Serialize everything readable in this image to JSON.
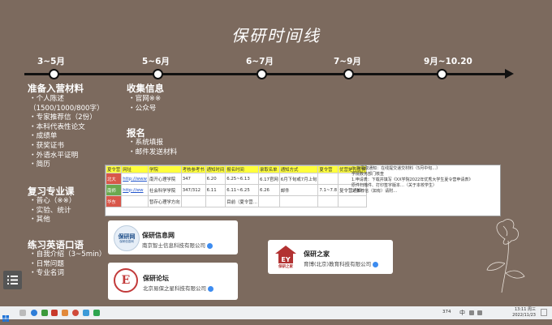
{
  "title": "保研时间线",
  "milestones": [
    "3~5月",
    "5~6月",
    "6~7月",
    "7~9月",
    "9月~10.20"
  ],
  "col1": {
    "sections": [
      {
        "title": "准备入营材料",
        "items": [
          "・个人陈述",
          "（1500/1000/800字）",
          "・专家推荐信（2份）",
          "・本科代表性论文",
          "・成绩单",
          "・获奖证书",
          "・外语水平证明",
          "・简历"
        ]
      },
      {
        "title": "复习专业课",
        "items": [
          "・普心（※※）",
          "・实验、统计",
          "・其他"
        ]
      },
      {
        "title": "练习英语口语",
        "items": [
          "・自我介绍（3~5min）",
          "・日常问题",
          "・专业名词"
        ]
      }
    ]
  },
  "col2": {
    "sections": [
      {
        "title": "收集信息",
        "items": [
          "・官网※※",
          "・公众号"
        ]
      },
      {
        "title": "报名",
        "items": [
          "・系统填报",
          "・邮件发送材料"
        ]
      }
    ]
  },
  "spreadsheet": {
    "headers": [
      "夏令营",
      "网址",
      "学院",
      "考核参考书",
      "通知时间",
      "报名时间",
      "录取名单",
      "通知方式",
      "夏令营",
      "优营是否直博"
    ],
    "rows": [
      {
        "tag": "北大",
        "cells": [
          "http://www",
          "南开心理学院",
          "347",
          "6.20",
          "6.25~6.13",
          "6.17官网",
          "6月下旬或7月上旬",
          ""
        ]
      },
      {
        "tag": "南师",
        "cells": [
          "http://ww",
          "社会科学学院",
          "347/312",
          "6.11",
          "6.11~6.25",
          "6.26",
          "邮件",
          "7.1~7.8",
          "复令营通知"
        ]
      },
      {
        "tag": "华东",
        "cells": [
          "",
          "暂存心理学方向",
          "",
          "",
          "目前（夏令营…",
          "",
          "",
          ""
        ]
      }
    ],
    "notes": [
      "① 拟录取通知：在线提交递交材料（5月中旬…）",
      "学院教务部门核查",
      "1.申请表：下载并填写《XX学院2022年优秀大学生夏令营申请表》",
      "原件扫描件、打印签字版本…（关于本校学生）",
      "① 推荐信（如有）请附…"
    ]
  },
  "cards": [
    {
      "logo_text": "保研网",
      "logo_sub": "保研信息网",
      "name": "保研信息网",
      "company": "南京智士信息科技有限公司"
    },
    {
      "logo_text": "E",
      "name": "保研论坛",
      "company": "北京易保之星科技有限公司"
    },
    {
      "logo_text": "保研之家",
      "name": "保研之家",
      "company": "育博(北京)教育科技有限公司"
    }
  ],
  "taskbar": {
    "time": "13:11 周三",
    "date": "2022/11/23",
    "ime": "中",
    "zoom": "374"
  },
  "colors": {
    "background": "#7c6a5e",
    "accent_green": "#6aa84f",
    "accent_red": "#d8574a"
  }
}
